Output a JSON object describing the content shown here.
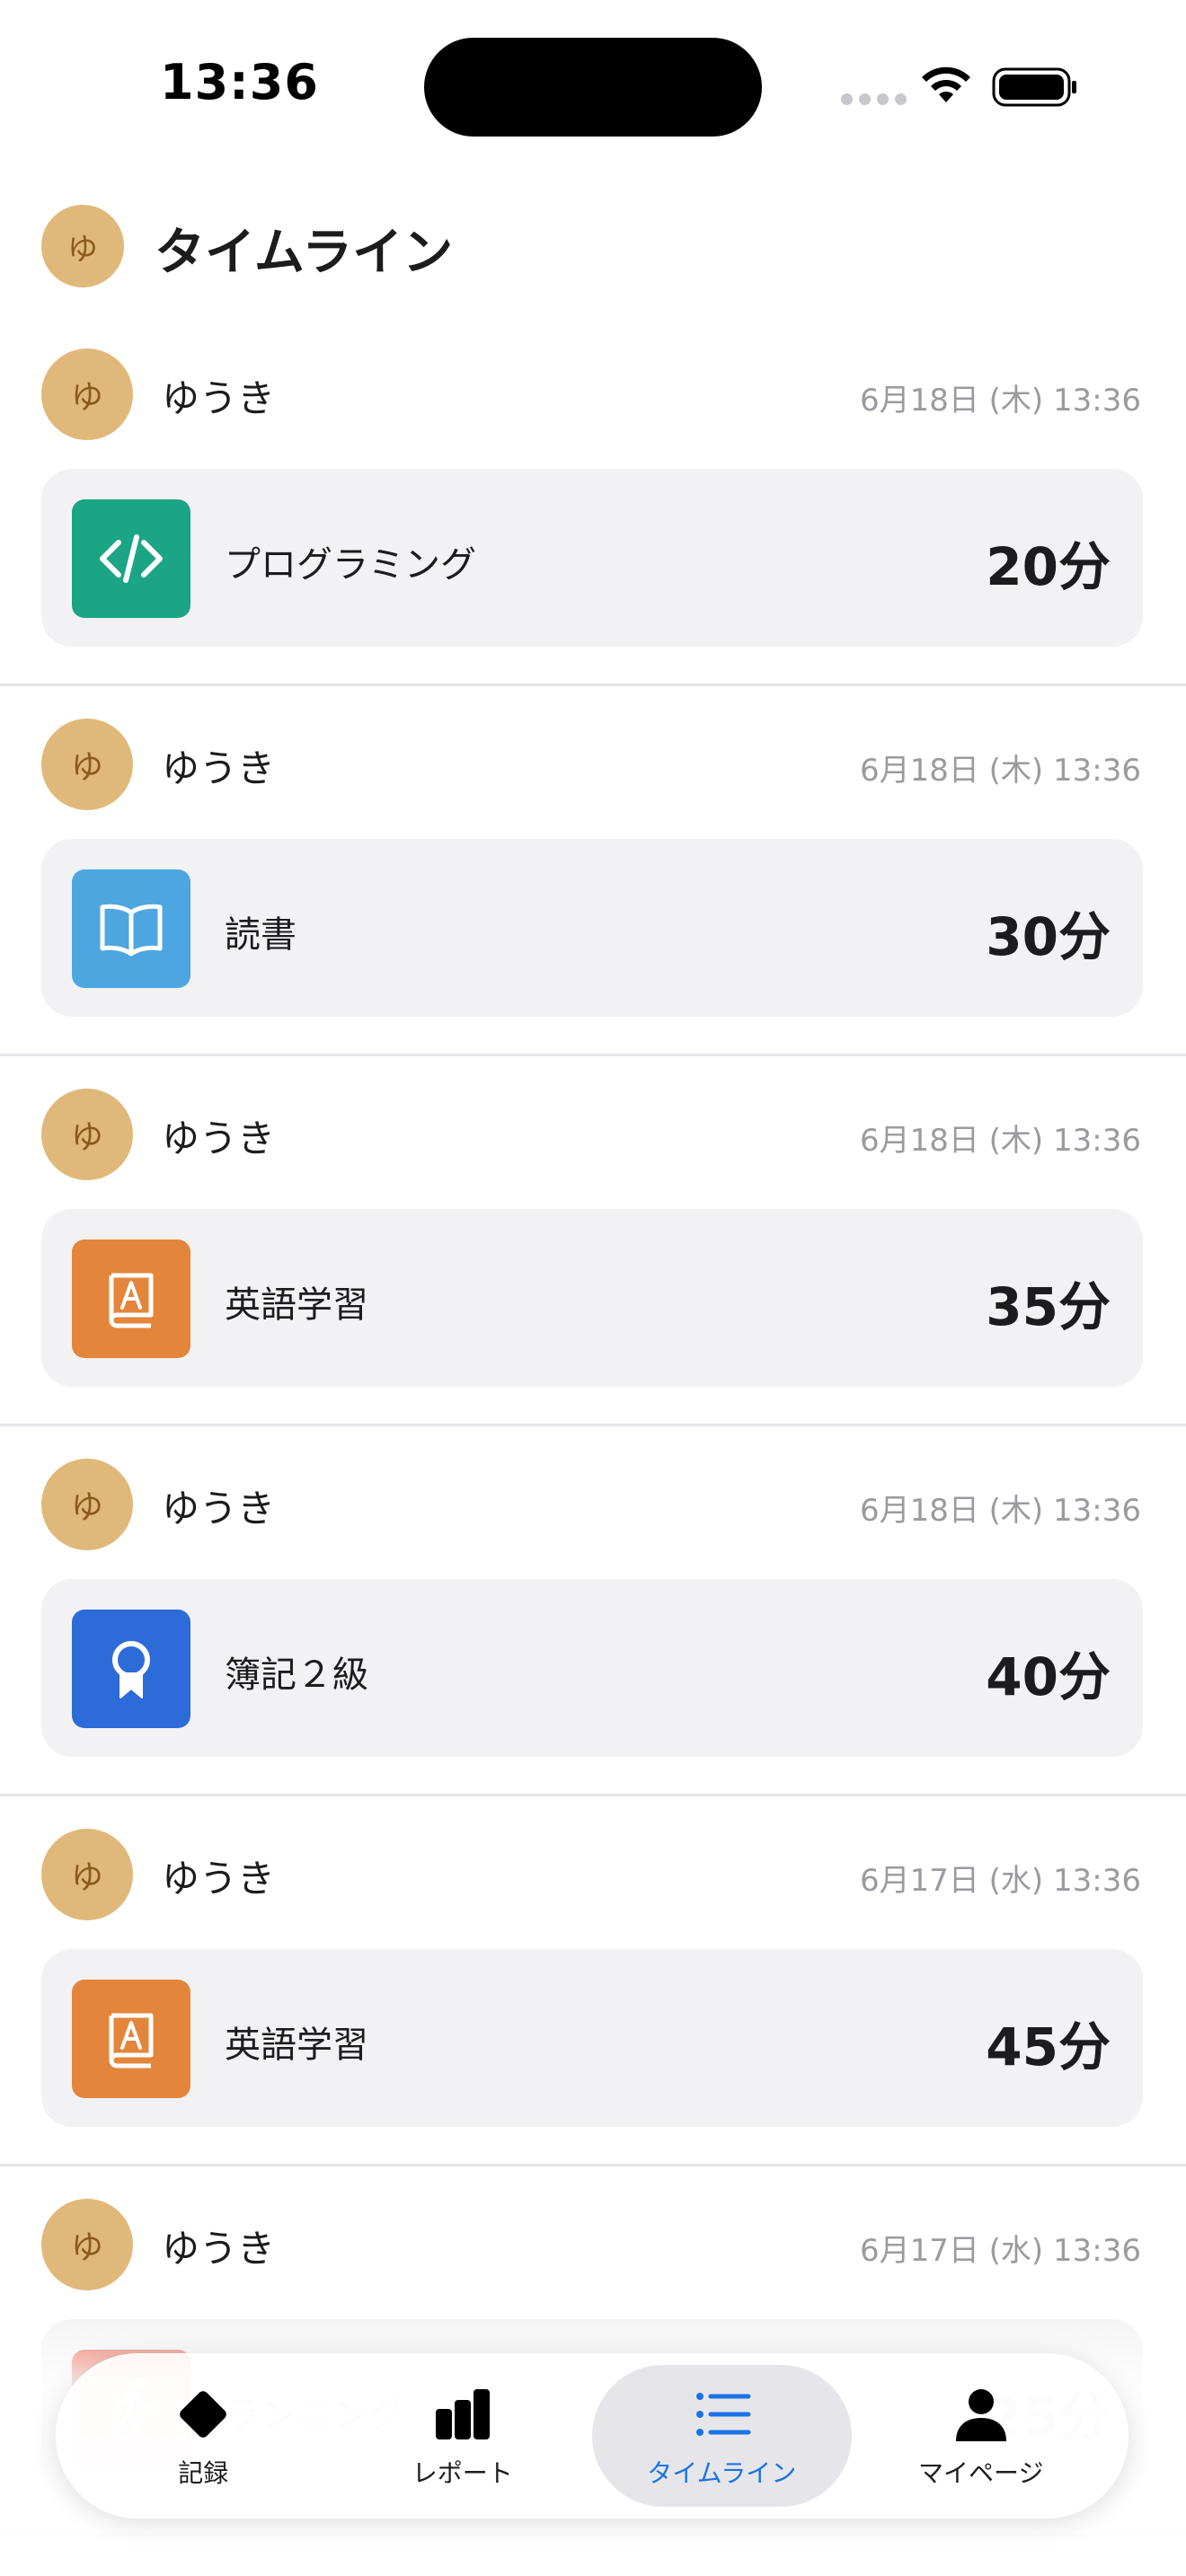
{
  "status_bar": {
    "time": "13:36"
  },
  "header": {
    "avatar_initial": "ゆ",
    "title": "タイムライン"
  },
  "posts": [
    {
      "avatar_initial": "ゆ",
      "user": "ゆうき",
      "timestamp": "6月18日 (木) 13:36",
      "activity": "プログラミング",
      "duration": "20分",
      "icon": "code-icon",
      "color": "#1ba585"
    },
    {
      "avatar_initial": "ゆ",
      "user": "ゆうき",
      "timestamp": "6月18日 (木) 13:36",
      "activity": "読書",
      "duration": "30分",
      "icon": "book-open-icon",
      "color": "#4ea6e0"
    },
    {
      "avatar_initial": "ゆ",
      "user": "ゆうき",
      "timestamp": "6月18日 (木) 13:36",
      "activity": "英語学習",
      "duration": "35分",
      "icon": "dictionary-icon",
      "color": "#e3863b"
    },
    {
      "avatar_initial": "ゆ",
      "user": "ゆうき",
      "timestamp": "6月18日 (木) 13:36",
      "activity": "簿記２級",
      "duration": "40分",
      "icon": "award-ribbon-icon",
      "color": "#2d6bd8"
    },
    {
      "avatar_initial": "ゆ",
      "user": "ゆうき",
      "timestamp": "6月17日 (水) 13:36",
      "activity": "英語学習",
      "duration": "45分",
      "icon": "dictionary-icon",
      "color": "#e3863b"
    },
    {
      "avatar_initial": "ゆ",
      "user": "ゆうき",
      "timestamp": "6月17日 (水) 13:36",
      "activity": "ランニング",
      "duration": "25分",
      "icon": "running-icon",
      "color": "#e8553e"
    }
  ],
  "tab_bar": {
    "items": [
      {
        "label": "記録",
        "icon": "diamond-icon",
        "active": false
      },
      {
        "label": "レポート",
        "icon": "bar-chart-icon",
        "active": false
      },
      {
        "label": "タイムライン",
        "icon": "list-icon",
        "active": true
      },
      {
        "label": "マイページ",
        "icon": "person-icon",
        "active": false
      }
    ],
    "active_color": "#1a73e8"
  }
}
